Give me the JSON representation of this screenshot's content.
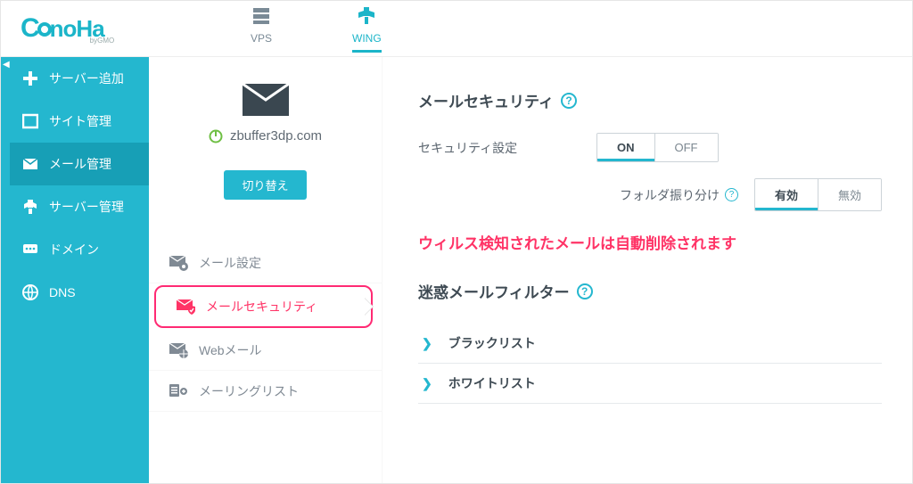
{
  "brand": {
    "name": "ConoHa",
    "sub": "byGMO"
  },
  "toptabs": {
    "vps": "VPS",
    "wing": "WING"
  },
  "sidebar": {
    "items": [
      {
        "label": "サーバー追加"
      },
      {
        "label": "サイト管理"
      },
      {
        "label": "メール管理"
      },
      {
        "label": "サーバー管理"
      },
      {
        "label": "ドメイン"
      },
      {
        "label": "DNS"
      }
    ]
  },
  "domain_panel": {
    "domain": "zbuffer3dp.com",
    "switch_label": "切り替え"
  },
  "subnav": {
    "items": [
      {
        "label": "メール設定"
      },
      {
        "label": "メールセキュリティ"
      },
      {
        "label": "Webメール"
      },
      {
        "label": "メーリングリスト"
      }
    ]
  },
  "main": {
    "title": "メールセキュリティ",
    "security_label": "セキュリティ設定",
    "on": "ON",
    "off": "OFF",
    "folder_label": "フォルダ振り分け",
    "enable": "有効",
    "disable": "無効",
    "annotation": "ウィルス検知されたメールは自動削除されます",
    "spam_title": "迷惑メールフィルター",
    "blacklist": "ブラックリスト",
    "whitelist": "ホワイトリスト"
  }
}
